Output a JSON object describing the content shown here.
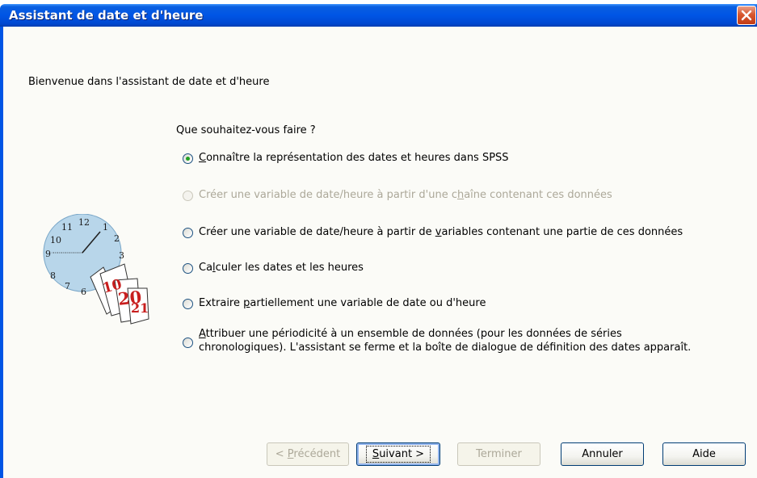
{
  "window": {
    "title": "Assistant de date et d'heure"
  },
  "welcome_text": "Bienvenue dans l'assistant de date et d'heure",
  "question": "Que souhaitez-vous faire ?",
  "options": [
    {
      "pre": "",
      "mn": "C",
      "post": "onnaître la représentation des dates et heures dans SPSS",
      "selected": true,
      "enabled": true
    },
    {
      "pre": "Créer une variable de date/heure à partir d'une c",
      "mn": "h",
      "post": "aîne contenant ces données",
      "selected": false,
      "enabled": false
    },
    {
      "pre": "Créer une variable de date/heure à partir de ",
      "mn": "v",
      "post": "ariables contenant une partie de ces données",
      "selected": false,
      "enabled": true
    },
    {
      "pre": "Ca",
      "mn": "l",
      "post": "culer les dates et les heures",
      "selected": false,
      "enabled": true
    },
    {
      "pre": "Extraire ",
      "mn": "p",
      "post": "artiellement une variable de date ou d'heure",
      "selected": false,
      "enabled": true
    },
    {
      "pre": "",
      "mn": "A",
      "post": "ttribuer une périodicité à un ensemble de données (pour les données de séries",
      "line2": "chronologiques). L'assistant se ferme et la boîte de dialogue de définition des dates apparaît.",
      "selected": false,
      "enabled": true
    }
  ],
  "buttons": {
    "previous": {
      "pre": "< ",
      "mn": "P",
      "post": "récédent"
    },
    "next": {
      "pre": "",
      "mn": "S",
      "post": "uivant >"
    },
    "finish": "Terminer",
    "cancel": "Annuler",
    "help": "Aide"
  },
  "icons": [
    "close-icon",
    "clock-calendar-icon",
    "radio-icon"
  ],
  "colors": {
    "titlebar": "#0055e5",
    "client_bg": "#fbfbf7",
    "close": "#d8582f",
    "radio_dot": "#21a121"
  },
  "clock_numbers": [
    "12",
    "1",
    "2",
    "3",
    "11",
    "10",
    "9",
    "8",
    "7",
    "6"
  ],
  "calendar_pages": [
    "10",
    "20",
    "21"
  ]
}
